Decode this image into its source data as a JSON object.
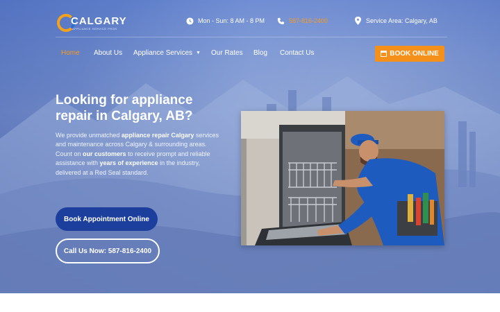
{
  "header": {
    "logo": {
      "word": "CALGARY",
      "tagline": "APPLIANCE SERVICE PROS"
    },
    "hours": {
      "icon": "clock-icon",
      "text": "Mon - Sun: 8 AM - 8 PM"
    },
    "phone": {
      "icon": "phone-icon",
      "text": "587-816-2400"
    },
    "area": {
      "icon": "map-pin-icon",
      "text": "Service Area: Calgary, AB"
    }
  },
  "nav": {
    "items": [
      {
        "label": "Home",
        "active": true
      },
      {
        "label": "About Us"
      },
      {
        "label": "Appliance Services",
        "has_dropdown": true
      },
      {
        "label": "Our Rates"
      },
      {
        "label": "Blog"
      },
      {
        "label": "Contact Us"
      }
    ],
    "cta": {
      "label": "BOOK ONLINE",
      "icon": "calendar-icon"
    }
  },
  "hero": {
    "headline": "Looking for appliance repair in Calgary, AB?",
    "lead": {
      "p1": "We provide unmatched ",
      "b1": "appliance repair Calgary",
      "p2": " services and maintenance across Calgary & surrounding areas. Count on ",
      "b2": "our customers",
      "p3": " to receive prompt and reliable assistance with ",
      "b3": "years of experience",
      "p4": " in the industry, delivered at a Red Seal standard."
    },
    "book_button": "Book Appointment Online",
    "call_button": "Call Us Now: 587-816-2400"
  },
  "colors": {
    "accent_orange": "#f5901a",
    "primary_blue": "#1c3f9e",
    "hero_overlay": "#7d9ad8",
    "white": "#ffffff"
  }
}
